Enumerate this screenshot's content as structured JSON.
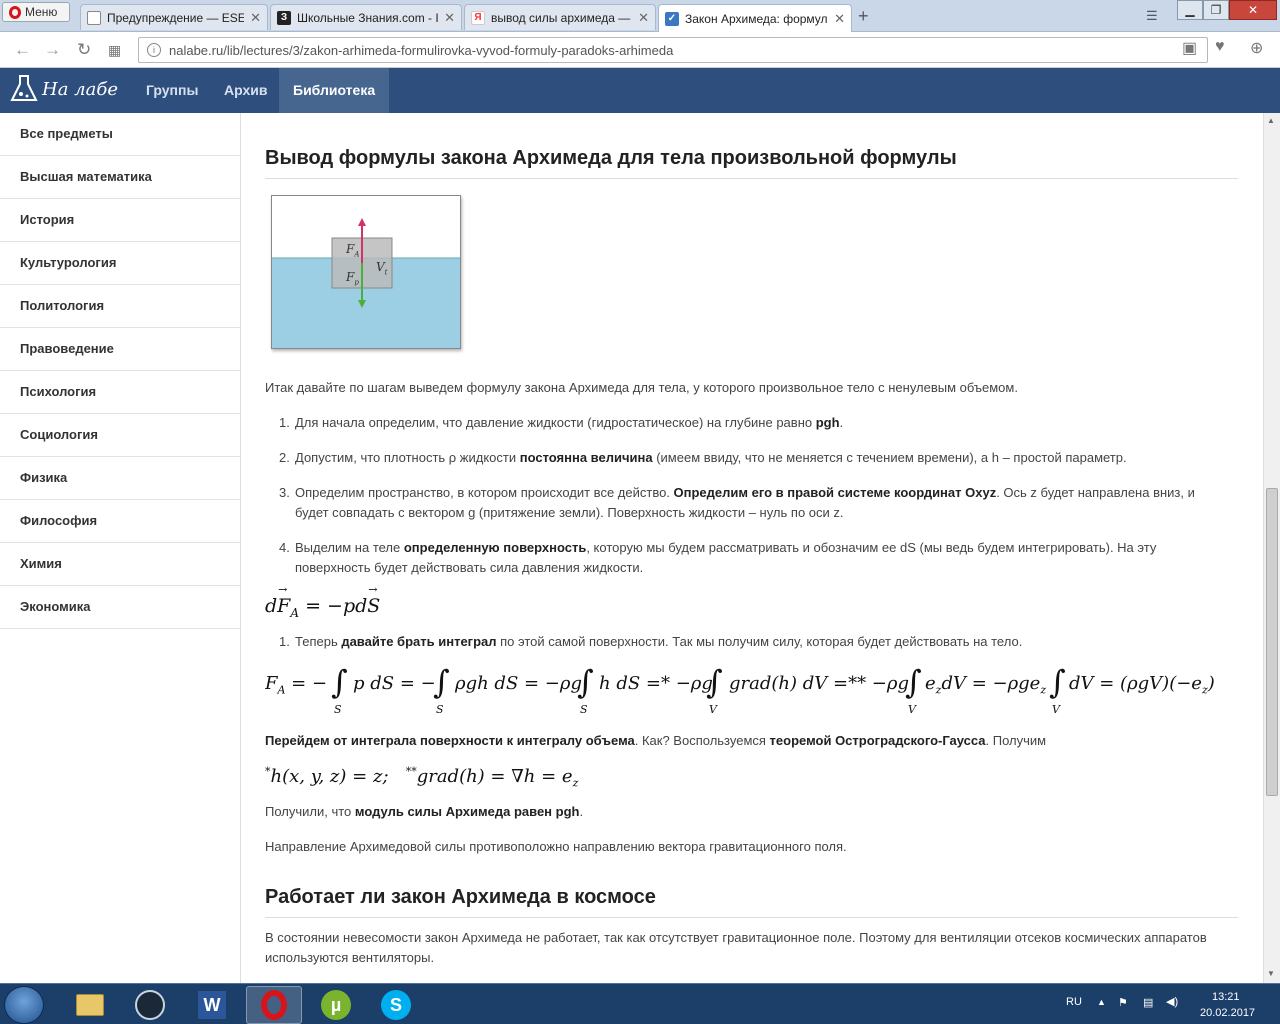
{
  "browser": {
    "menu_label": "Меню",
    "tabs": [
      {
        "title": "Предупреждение — ESET",
        "color": "#2a8bd0"
      },
      {
        "title": "Школьные Знания.com - I",
        "color": "#222222"
      },
      {
        "title": "вывод силы архимеда —",
        "color": "#ff3333"
      },
      {
        "title": "Закон Архимеда: формул",
        "color": "#3a78c2"
      }
    ],
    "active_tab": 3,
    "url": "nalabe.ru/lib/lectures/3/zakon-arhimeda-formulirovka-vyvod-formuly-paradoks-arhimeda"
  },
  "site": {
    "logo_text": "На лабе",
    "nav": [
      "Группы",
      "Архив",
      "Библиотека"
    ],
    "active_nav": "Библиотека"
  },
  "sidebar": {
    "items": [
      {
        "label": "Все предметы"
      },
      {
        "label": "Высшая математика"
      },
      {
        "label": "История"
      },
      {
        "label": "Культурология"
      },
      {
        "label": "Политология"
      },
      {
        "label": "Правоведение"
      },
      {
        "label": "Психология"
      },
      {
        "label": "Социология"
      },
      {
        "label": "Физика"
      },
      {
        "label": "Философия"
      },
      {
        "label": "Химия"
      },
      {
        "label": "Экономика"
      }
    ]
  },
  "article": {
    "heading1": "Вывод формулы закона Архимеда для тела произвольной формулы",
    "figure": {
      "label_fa": "F",
      "sub_fa": "A",
      "label_fp": "F",
      "sub_fp": "p",
      "label_v": "V",
      "sub_v": "t"
    },
    "intro": "Итак давайте по шагам выведем формулу закона Архимеда для тела, у которого произвольное тело с ненулевым объемом.",
    "steps": [
      {
        "num": "1.",
        "a": "Для начала определим, что давление жидкости (гидростатическое) на глубине равно ",
        "b": "pgh",
        "c": "."
      },
      {
        "num": "2.",
        "a": "Допустим, что плотность ρ жидкости ",
        "b": "постоянна величина",
        "c": " (имеем ввиду, что не меняется с течением времени), а h – простой параметр."
      },
      {
        "num": "3.",
        "a": "Определим пространство, в котором происходит все действо. ",
        "b": "Определим его в правой системе координат Oxyz",
        "c": ". Ось z будет направлена вниз, и будет совпадать с вектором g (притяжение земли). Поверхность жидкости – нуль по оси z."
      },
      {
        "num": "4.",
        "a": "Выделим на теле ",
        "b": "определенную поверхность",
        "c": ", которую мы будем рассматривать и обозначим ее dS (мы ведь будем интегрировать). На эту поверхность будет действовать сила давления жидкости."
      }
    ],
    "step5": {
      "num": "1.",
      "a": "Теперь ",
      "b": "давайте брать интеграл",
      "c": " по этой самой поверхности. Так мы получим силу, которая будет действовать на тело."
    },
    "transition": {
      "b1": "Перейдем от интеграла поверхности к интегралу объема",
      "a": ". Как? Воспользуемся ",
      "b2": "теоремой Остроградского-Гаусса",
      "c": ". Получим"
    },
    "result": {
      "a": "Получили, что ",
      "b": "модуль силы Архимеда равен pgh",
      "c": "."
    },
    "direction": "Направление Архимедовой силы противоположно направлению вектора гравитационного поля.",
    "heading2": "Работает ли закон Архимеда в космосе",
    "space": "В состоянии невесомости закон Архимеда не работает, так как отсутствует гравитационное поле. Поэтому для вентиляции отсеков космических аппаратов используются вентиляторы."
  },
  "taskbar": {
    "lang": "RU",
    "time": "13:21",
    "date": "20.02.2017"
  }
}
